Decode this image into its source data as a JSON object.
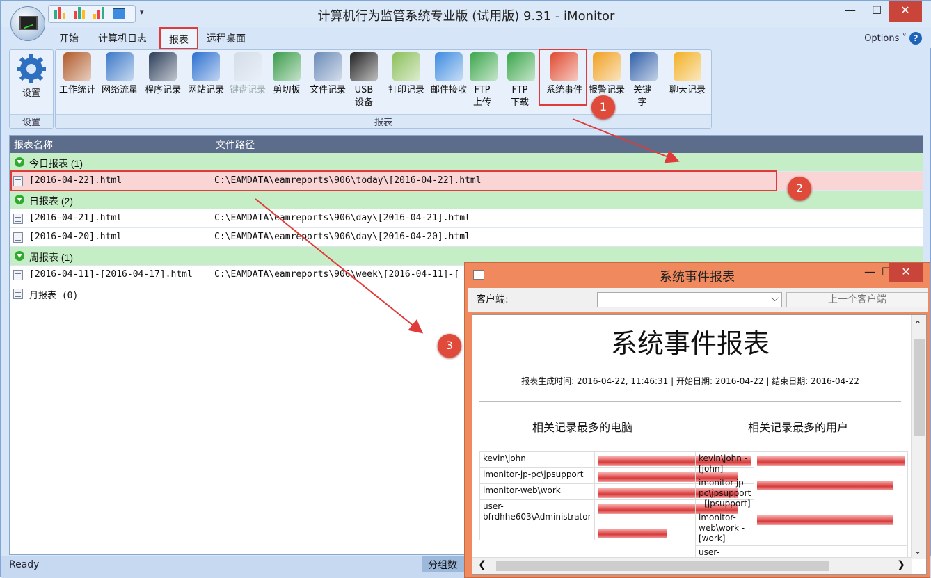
{
  "window": {
    "title": "计算机行为监管系统专业版 (试用版) 9.31 - iMonitor",
    "minimize": "—",
    "maximize": "☐",
    "close": "✕"
  },
  "tabs": [
    {
      "label": "开始"
    },
    {
      "label": "计算机日志"
    },
    {
      "label": "报表"
    },
    {
      "label": "远程桌面"
    }
  ],
  "options_label": "Options",
  "ribbon": {
    "settings_group": {
      "label": "设置",
      "button": "设置"
    },
    "reports_group": {
      "label": "报表",
      "buttons": [
        {
          "label": "工作统计",
          "icon": "people-chart-icon"
        },
        {
          "label": "网络流量",
          "icon": "network-computers-icon"
        },
        {
          "label": "程序记录",
          "icon": "console-icon"
        },
        {
          "label": "网站记录",
          "icon": "globe-icon"
        },
        {
          "label": "键盘记录",
          "icon": "keyboard-icon",
          "disabled": true
        },
        {
          "label": "剪切板",
          "icon": "clipboard-icon"
        },
        {
          "label": "文件记录",
          "icon": "file-icon"
        },
        {
          "label": "USB",
          "label2": "设备",
          "icon": "usb-icon"
        },
        {
          "label": "打印记录",
          "icon": "printer-icon"
        },
        {
          "label": "邮件接收",
          "icon": "mail-icon"
        },
        {
          "label": "FTP",
          "label2": "上传",
          "icon": "upload-icon"
        },
        {
          "label": "FTP",
          "label2": "下载",
          "icon": "download-icon"
        },
        {
          "label": "系统事件",
          "icon": "windows-logo-icon"
        },
        {
          "label": "报警记录",
          "icon": "warning-icon"
        },
        {
          "label": "关键字",
          "icon": "keyword-doc-icon"
        },
        {
          "label": "聊天记录",
          "icon": "chat-icon"
        }
      ]
    }
  },
  "callouts": [
    "1",
    "2",
    "3"
  ],
  "list": {
    "columns": [
      "报表名称",
      "文件路径"
    ],
    "rows": [
      {
        "type": "group",
        "name": "今日报表 (1)"
      },
      {
        "type": "file",
        "name": "[2016-04-22].html",
        "path": "C:\\EAMDATA\\eamreports\\906\\today\\[2016-04-22].html",
        "selected": true
      },
      {
        "type": "group",
        "name": "日报表 (2)"
      },
      {
        "type": "file",
        "name": "[2016-04-21].html",
        "path": "C:\\EAMDATA\\eamreports\\906\\day\\[2016-04-21].html"
      },
      {
        "type": "file",
        "name": "[2016-04-20].html",
        "path": "C:\\EAMDATA\\eamreports\\906\\day\\[2016-04-20].html"
      },
      {
        "type": "group",
        "name": "周报表 (1)"
      },
      {
        "type": "file",
        "name": "[2016-04-11]-[2016-04-17].html",
        "path": "C:\\EAMDATA\\eamreports\\906\\week\\[2016-04-11]-["
      },
      {
        "type": "file",
        "name": "月报表 (0)",
        "path": ""
      }
    ]
  },
  "status": {
    "ready": "Ready",
    "group_count": "分组数"
  },
  "popup": {
    "title": "系统事件报表",
    "client_label": "客户端:",
    "prev_client": "上一个客户端",
    "report": {
      "heading": "系统事件报表",
      "meta": "报表生成时间: 2016-04-22, 11:46:31 | 开始日期: 2016-04-22 | 结束日期: 2016-04-22",
      "left_title": "相关记录最多的电脑",
      "right_title": "相关记录最多的用户",
      "computers": [
        {
          "name": "kevin\\john",
          "value": 1.0
        },
        {
          "name": "imonitor-jp-pc\\jpsupport",
          "value": 0.92
        },
        {
          "name": "imonitor-web\\work",
          "value": 0.92
        },
        {
          "name": "user-bfrdhhe603\\Administrator",
          "value": 0.92
        },
        {
          "name": "",
          "value": 0.45
        }
      ],
      "users": [
        {
          "name": "kevin\\john - [john]",
          "value": 1.0
        },
        {
          "name": "imonitor-jp-pc\\jpsupport - [jpsupport]",
          "value": 0.92
        },
        {
          "name": "imonitor-web\\work - [work]",
          "value": 0.92
        },
        {
          "name": "user-",
          "value": 0
        }
      ]
    }
  }
}
